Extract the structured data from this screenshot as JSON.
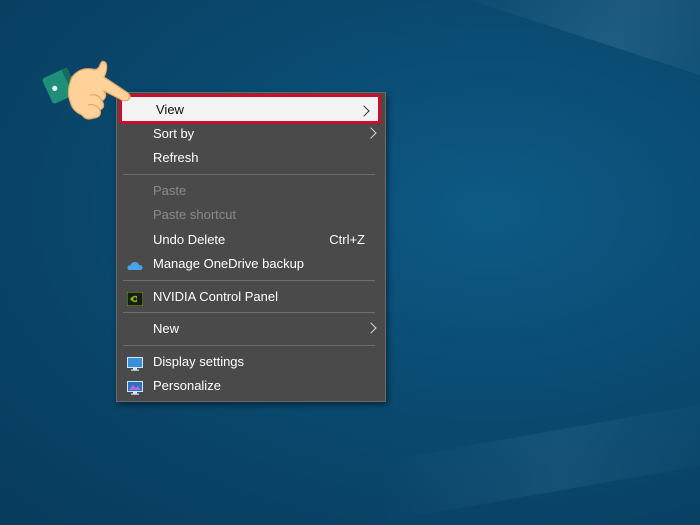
{
  "menu": {
    "items": [
      {
        "label": "View",
        "has_submenu": true,
        "highlighted": true
      },
      {
        "label": "Sort by",
        "has_submenu": true
      },
      {
        "label": "Refresh"
      },
      {
        "label": "Paste",
        "disabled": true
      },
      {
        "label": "Paste shortcut",
        "disabled": true
      },
      {
        "label": "Undo Delete",
        "shortcut": "Ctrl+Z"
      },
      {
        "label": "Manage OneDrive backup",
        "icon": "onedrive-cloud-icon"
      },
      {
        "label": "NVIDIA Control Panel",
        "icon": "nvidia-icon"
      },
      {
        "label": "New",
        "has_submenu": true
      },
      {
        "label": "Display settings",
        "icon": "display-monitor-icon"
      },
      {
        "label": "Personalize",
        "icon": "personalize-monitor-icon"
      }
    ]
  },
  "colors": {
    "desktop": "#0a4a70",
    "menu_bg": "#4a4a4a",
    "highlight_border": "#c8102e",
    "disabled_text": "#8a8a8a"
  },
  "pointer": {
    "icon": "pointing-hand-icon"
  }
}
